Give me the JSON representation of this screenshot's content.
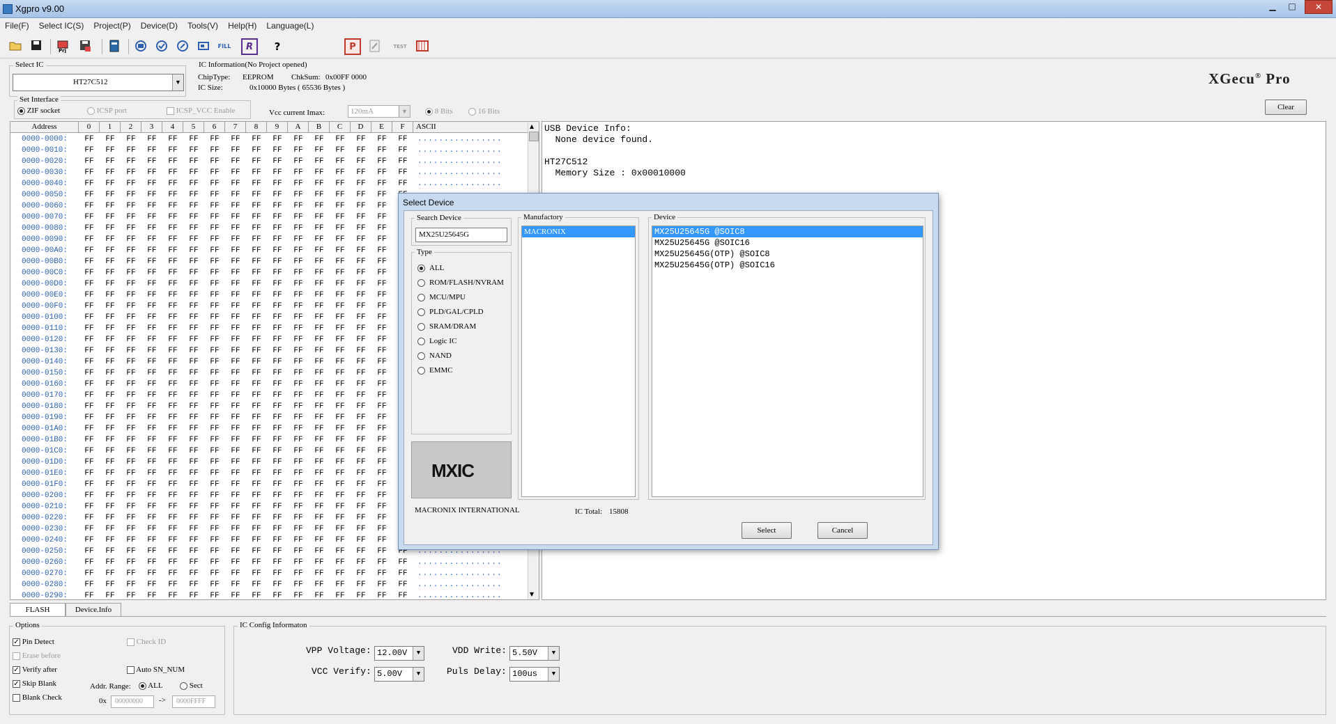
{
  "window": {
    "title": "Xgpro v9.00",
    "min": "▁",
    "max": "□",
    "close": "✕"
  },
  "menu": [
    "File(F)",
    "Select IC(S)",
    "Project(P)",
    "Device(D)",
    "Tools(V)",
    "Help(H)",
    "Language(L)"
  ],
  "toolbar": {
    "icons": [
      "open-icon",
      "save-icon",
      "project-icon",
      "save-project-icon",
      "chip-icon",
      "read-icon",
      "verify-icon",
      "program-icon",
      "erase-icon",
      "fill-icon",
      "r-icon",
      "help-icon",
      "p-icon",
      "edit-icon",
      "test-icon",
      "module-icon"
    ],
    "fill_label": "FILL",
    "r_label": "R",
    "help_label": "?",
    "p_label": "P",
    "test_label": "TEST"
  },
  "select_ic": {
    "label": "Select IC",
    "value": "HT27C512"
  },
  "ic_info": {
    "label": "IC Information(No Project opened)",
    "chiptype_label": "ChipType:",
    "chiptype": "EEPROM",
    "checksum_label": "ChkSum:",
    "checksum": "0x00FF 0000",
    "size_label": "IC Size:",
    "size": "0x10000 Bytes ( 65536 Bytes )"
  },
  "logo": {
    "text": "XGecu",
    "reg": "®",
    "suffix": "Pro"
  },
  "interface": {
    "label": "Set Interface",
    "zif": "ZIF socket",
    "icsp": "ICSP port",
    "icsp_vcc": "ICSP_VCC Enable",
    "vcc_label": "Vcc current Imax:",
    "vcc_value": "120mA",
    "bits8": "8 Bits",
    "bits16": "16 Bits"
  },
  "clear_button": "Clear",
  "hex": {
    "address_header": "Address",
    "columns": [
      "0",
      "1",
      "2",
      "3",
      "4",
      "5",
      "6",
      "7",
      "8",
      "9",
      "A",
      "B",
      "C",
      "D",
      "E",
      "F"
    ],
    "ascii_header": "ASCII",
    "rows": [
      "0000-0000:",
      "0000-0010:",
      "0000-0020:",
      "0000-0030:",
      "0000-0040:",
      "0000-0050:",
      "0000-0060:",
      "0000-0070:",
      "0000-0080:",
      "0000-0090:",
      "0000-00A0:",
      "0000-00B0:",
      "0000-00C0:",
      "0000-00D0:",
      "0000-00E0:",
      "0000-00F0:",
      "0000-0100:",
      "0000-0110:",
      "0000-0120:",
      "0000-0130:",
      "0000-0140:",
      "0000-0150:",
      "0000-0160:",
      "0000-0170:",
      "0000-0180:",
      "0000-0190:",
      "0000-01A0:",
      "0000-01B0:",
      "0000-01C0:",
      "0000-01D0:",
      "0000-01E0:",
      "0000-01F0:",
      "0000-0200:",
      "0000-0210:",
      "0000-0220:",
      "0000-0230:",
      "0000-0240:",
      "0000-0250:",
      "0000-0260:",
      "0000-0270:",
      "0000-0280:",
      "0000-0290:"
    ],
    "byte": "FF",
    "ascii": "................"
  },
  "info_text": "USB Device Info:\n  None device found.\n\nHT27C512\n  Memory Size : 0x00010000",
  "tabs": [
    "FLASH",
    "Device.Info"
  ],
  "options": {
    "label": "Options",
    "pin_detect": "Pin Detect",
    "check_id": "Check ID",
    "erase_before": "Erase before",
    "verify_after": "Verify after",
    "auto_sn": "Auto SN_NUM",
    "skip_blank": "Skip Blank",
    "blank_check": "Blank Check",
    "addr_range": "Addr. Range:",
    "all": "ALL",
    "sect": "Sect",
    "ox": "0x",
    "from": "00000000",
    "arrow": "->",
    "to": "0000FFFF"
  },
  "ic_config": {
    "label": "IC Config Informaton",
    "vpp_label": "VPP Voltage:",
    "vpp": "12.00V",
    "vcc_label": "VCC Verify:",
    "vcc": "5.00V",
    "vdd_label": "VDD Write:",
    "vdd": "5.50V",
    "puls_label": "Puls Delay:",
    "puls": "100us"
  },
  "dialog": {
    "title": "Select Device",
    "search_label": "Search Device",
    "search_value": "MX25U25645G",
    "type_label": "Type",
    "types": [
      "ALL",
      "ROM/FLASH/NVRAM",
      "MCU/MPU",
      "PLD/GAL/CPLD",
      "SRAM/DRAM",
      "Logic IC",
      "NAND",
      "EMMC"
    ],
    "manufactory_label": "Manufactory",
    "manufactories": [
      "MACRONIX"
    ],
    "device_label": "Device",
    "devices": [
      "MX25U25645G @SOIC8",
      "MX25U25645G @SOIC16",
      "MX25U25645G(OTP) @SOIC8",
      "MX25U25645G(OTP) @SOIC16"
    ],
    "logo_text": "MXIC",
    "manufacturer_name": "MACRONIX INTERNATIONAL",
    "ic_total_label": "IC Total:",
    "ic_total": "15808",
    "select_button": "Select",
    "cancel_button": "Cancel"
  },
  "colors": {
    "selection": "#3399ff",
    "address": "#2c5fb8",
    "titlebar": "#b8d1ee"
  }
}
